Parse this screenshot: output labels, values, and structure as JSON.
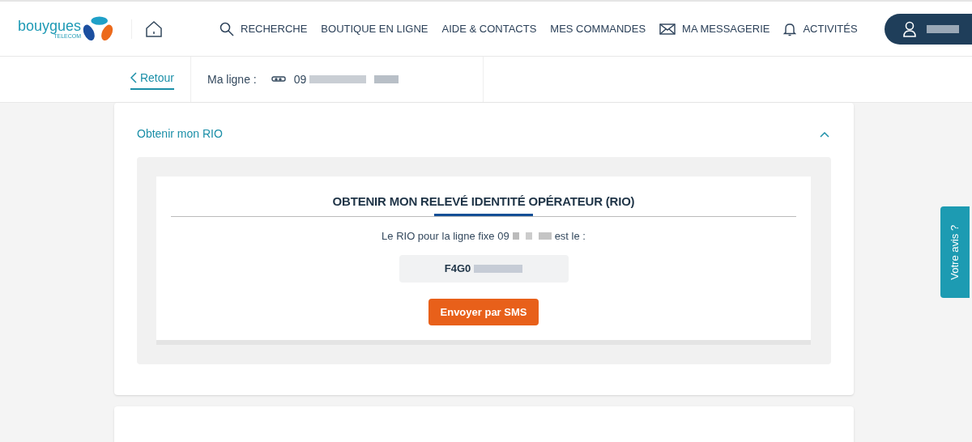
{
  "logo": {
    "name": "bouygues",
    "tagline": "TELECOM"
  },
  "nav": [
    {
      "label": "RECHERCHE",
      "kind": "search"
    },
    {
      "label": "BOUTIQUE EN LIGNE",
      "kind": "plain"
    },
    {
      "label": "AIDE & CONTACTS",
      "kind": "plain"
    },
    {
      "label": "MES COMMANDES",
      "kind": "plain"
    },
    {
      "label": "MA MESSAGERIE",
      "kind": "mail"
    },
    {
      "label": "ACTIVITÉS",
      "kind": "bell"
    }
  ],
  "subheader": {
    "back": "Retour",
    "line_label": "Ma ligne :",
    "line_number": "09"
  },
  "section": {
    "title": "Obtenir mon RIO",
    "expanded": true,
    "heading": "OBTENIR MON RELEVÉ IDENTITÉ OPÉRATEUR (RIO)",
    "sentence_start": "Le RIO pour la ligne fixe 09",
    "sentence_end": "est le :",
    "rio_code": "F4G0",
    "button": "Envoyer par SMS"
  },
  "feedback_tab": "Votre avis ?"
}
